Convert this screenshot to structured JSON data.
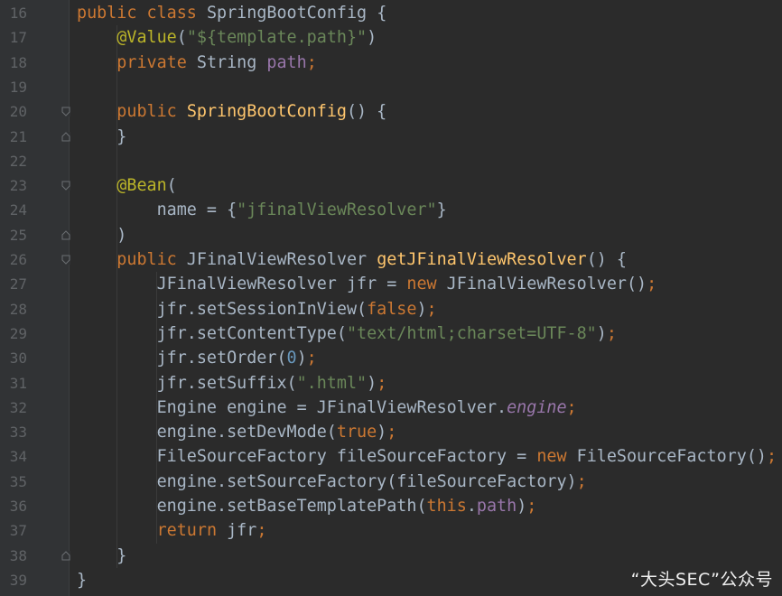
{
  "lines": [
    {
      "n": "16",
      "tokens": [
        {
          "t": "kw",
          "v": "public"
        },
        {
          "t": "",
          "v": " "
        },
        {
          "t": "kw",
          "v": "class"
        },
        {
          "t": "",
          "v": " SpringBootConfig {"
        }
      ]
    },
    {
      "n": "17",
      "tokens": [
        {
          "t": "",
          "v": "    "
        },
        {
          "t": "ann",
          "v": "@Value"
        },
        {
          "t": "",
          "v": "("
        },
        {
          "t": "str",
          "v": "\"${template.path}\""
        },
        {
          "t": "",
          "v": ")"
        }
      ]
    },
    {
      "n": "18",
      "tokens": [
        {
          "t": "",
          "v": "    "
        },
        {
          "t": "kw",
          "v": "private"
        },
        {
          "t": "",
          "v": " String "
        },
        {
          "t": "fld",
          "v": "path"
        },
        {
          "t": "kw",
          "v": ";"
        }
      ]
    },
    {
      "n": "19",
      "tokens": []
    },
    {
      "n": "20",
      "tokens": [
        {
          "t": "",
          "v": "    "
        },
        {
          "t": "kw",
          "v": "public"
        },
        {
          "t": "",
          "v": " "
        },
        {
          "t": "fn",
          "v": "SpringBootConfig"
        },
        {
          "t": "",
          "v": "() {"
        }
      ]
    },
    {
      "n": "21",
      "tokens": [
        {
          "t": "",
          "v": "    }"
        }
      ]
    },
    {
      "n": "22",
      "tokens": []
    },
    {
      "n": "23",
      "tokens": [
        {
          "t": "",
          "v": "    "
        },
        {
          "t": "ann",
          "v": "@Bean"
        },
        {
          "t": "",
          "v": "("
        }
      ]
    },
    {
      "n": "24",
      "tokens": [
        {
          "t": "",
          "v": "        name = {"
        },
        {
          "t": "str",
          "v": "\"jfinalViewResolver\""
        },
        {
          "t": "",
          "v": "}"
        }
      ]
    },
    {
      "n": "25",
      "tokens": [
        {
          "t": "",
          "v": "    )"
        }
      ]
    },
    {
      "n": "26",
      "tokens": [
        {
          "t": "",
          "v": "    "
        },
        {
          "t": "kw",
          "v": "public"
        },
        {
          "t": "",
          "v": " JFinalViewResolver "
        },
        {
          "t": "fn",
          "v": "getJFinalViewResolver"
        },
        {
          "t": "",
          "v": "() {"
        }
      ]
    },
    {
      "n": "27",
      "tokens": [
        {
          "t": "",
          "v": "        JFinalViewResolver jfr = "
        },
        {
          "t": "kw",
          "v": "new"
        },
        {
          "t": "",
          "v": " JFinalViewResolver()"
        },
        {
          "t": "kw",
          "v": ";"
        }
      ]
    },
    {
      "n": "28",
      "tokens": [
        {
          "t": "",
          "v": "        jfr.setSessionInView("
        },
        {
          "t": "kw",
          "v": "false"
        },
        {
          "t": "",
          "v": ")"
        },
        {
          "t": "kw",
          "v": ";"
        }
      ]
    },
    {
      "n": "29",
      "tokens": [
        {
          "t": "",
          "v": "        jfr.setContentType("
        },
        {
          "t": "str",
          "v": "\"text/html;charset=UTF-8\""
        },
        {
          "t": "",
          "v": ")"
        },
        {
          "t": "kw",
          "v": ";"
        }
      ]
    },
    {
      "n": "30",
      "tokens": [
        {
          "t": "",
          "v": "        jfr.setOrder("
        },
        {
          "t": "num",
          "v": "0"
        },
        {
          "t": "",
          "v": ")"
        },
        {
          "t": "kw",
          "v": ";"
        }
      ]
    },
    {
      "n": "31",
      "tokens": [
        {
          "t": "",
          "v": "        jfr.setSuffix("
        },
        {
          "t": "str",
          "v": "\".html\""
        },
        {
          "t": "",
          "v": ")"
        },
        {
          "t": "kw",
          "v": ";"
        }
      ]
    },
    {
      "n": "32",
      "tokens": [
        {
          "t": "",
          "v": "        Engine engine = JFinalViewResolver."
        },
        {
          "t": "fldi",
          "v": "engine"
        },
        {
          "t": "kw",
          "v": ";"
        }
      ]
    },
    {
      "n": "33",
      "tokens": [
        {
          "t": "",
          "v": "        engine.setDevMode("
        },
        {
          "t": "kw",
          "v": "true"
        },
        {
          "t": "",
          "v": ")"
        },
        {
          "t": "kw",
          "v": ";"
        }
      ]
    },
    {
      "n": "34",
      "tokens": [
        {
          "t": "",
          "v": "        FileSourceFactory fileSourceFactory = "
        },
        {
          "t": "kw",
          "v": "new"
        },
        {
          "t": "",
          "v": " FileSourceFactory()"
        },
        {
          "t": "kw",
          "v": ";"
        }
      ]
    },
    {
      "n": "35",
      "tokens": [
        {
          "t": "",
          "v": "        engine.setSourceFactory(fileSourceFactory)"
        },
        {
          "t": "kw",
          "v": ";"
        }
      ]
    },
    {
      "n": "36",
      "tokens": [
        {
          "t": "",
          "v": "        engine.setBaseTemplatePath("
        },
        {
          "t": "kw",
          "v": "this"
        },
        {
          "t": "",
          "v": "."
        },
        {
          "t": "fld",
          "v": "path"
        },
        {
          "t": "",
          "v": ")"
        },
        {
          "t": "kw",
          "v": ";"
        }
      ]
    },
    {
      "n": "37",
      "tokens": [
        {
          "t": "",
          "v": "        "
        },
        {
          "t": "kw",
          "v": "return"
        },
        {
          "t": "",
          "v": " jfr"
        },
        {
          "t": "kw",
          "v": ";"
        }
      ]
    },
    {
      "n": "38",
      "tokens": [
        {
          "t": "",
          "v": "    }"
        }
      ]
    },
    {
      "n": "39",
      "tokens": [
        {
          "t": "",
          "v": "}"
        }
      ]
    }
  ],
  "fold_markers": {
    "20": "open",
    "21": "close",
    "23": "open",
    "25": "close",
    "26": "open",
    "38": "close"
  },
  "watermark": "“大头SEC”公众号",
  "colors": {
    "background": "#2b2b2b",
    "gutter": "#313335",
    "keyword": "#cc7832",
    "annotation": "#bbb529",
    "string": "#6a8759",
    "method": "#ffc66d",
    "field": "#9876aa",
    "number": "#6897bb",
    "text": "#a9b7c6"
  }
}
